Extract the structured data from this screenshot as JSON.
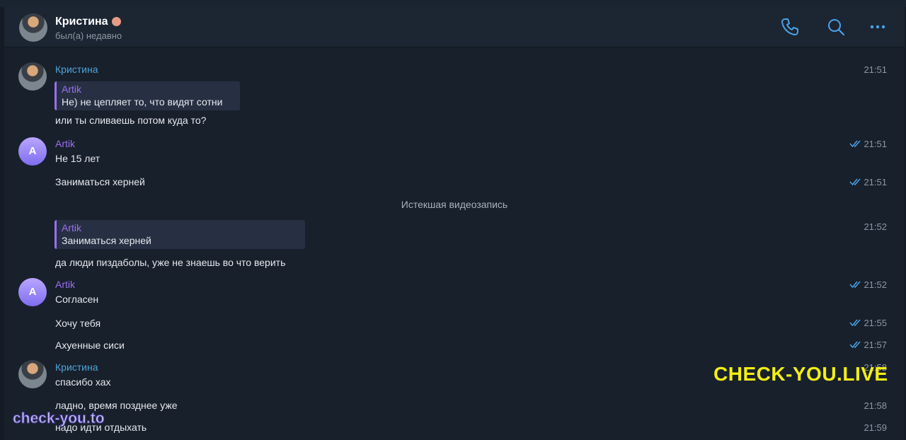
{
  "header": {
    "name": "Кристина",
    "status": "был(а) недавно"
  },
  "messages": {
    "m1": {
      "sender": "Кристина",
      "time": "21:51",
      "reply_name": "Artik",
      "reply_text": "Не) не цепляет то, что видят сотни",
      "text": "или ты сливаешь потом куда то?"
    },
    "m2": {
      "sender": "Artik",
      "avatar_letter": "A",
      "text": "Не 15 лет",
      "time": "21:51"
    },
    "m3": {
      "text": "Заниматься херней",
      "time": "21:51"
    },
    "service": "Истекшая видеозапись",
    "m4": {
      "time": "21:52",
      "reply_name": "Artik",
      "reply_text": "Заниматься херней",
      "text": "да люди пиздаболы, уже не знаешь во что верить"
    },
    "m5": {
      "sender": "Artik",
      "avatar_letter": "A",
      "text": "Согласен",
      "time": "21:52"
    },
    "m6": {
      "text": "Хочу тебя",
      "time": "21:55"
    },
    "m7": {
      "text": "Ахуенные сиси",
      "time": "21:57"
    },
    "m8": {
      "sender": "Кристина",
      "text": "спасибо хах",
      "time": "21:58"
    },
    "m9": {
      "text": "ладно, время позднее уже",
      "time": "21:58"
    },
    "m10": {
      "text": "надо идти отдыхать",
      "time": "21:59"
    }
  },
  "watermarks": {
    "live": "CHECK-YOU.LIVE",
    "to": "check-you.to"
  },
  "colors": {
    "background": "#18202c",
    "accent_blue": "#4ea5d9",
    "accent_purple": "#9b6ff0",
    "watermark_yellow": "#f3ee14"
  },
  "icons": {
    "call": "phone-icon",
    "search": "search-icon",
    "more": "more-dots-icon",
    "read": "double-check-icon"
  }
}
